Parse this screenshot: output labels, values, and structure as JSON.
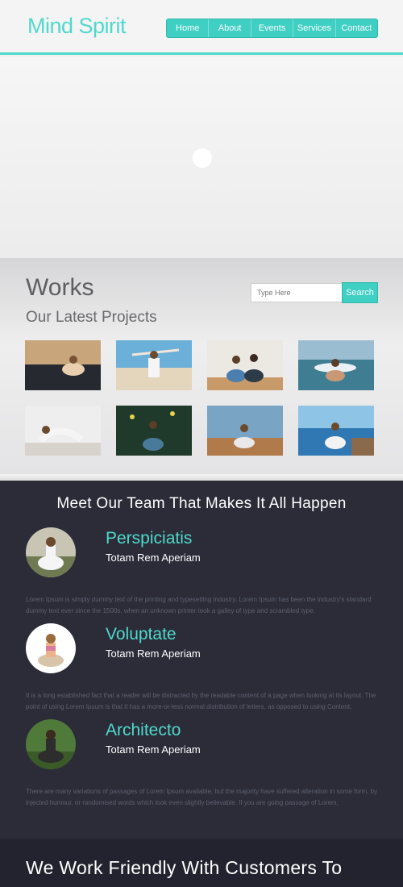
{
  "header": {
    "logo": "Mind Spirit",
    "nav": [
      "Home",
      "About",
      "Events",
      "Services",
      "Contact"
    ]
  },
  "works": {
    "title": "Works",
    "subtitle": "Our Latest Projects",
    "search_placeholder": "Type Here",
    "search_button": "Search"
  },
  "team": {
    "heading": "Meet Our Team That Makes It All Happen",
    "members": [
      {
        "name": "Perspiciatis",
        "role": "Totam Rem Aperiam",
        "desc": "Lorem Ipsum is simply dummy text of the printing and typesetting industry. Lorem Ipsum has been the industry's standard dummy text ever since the 1500s, when an unknown printer took a galley of type and scrambled type."
      },
      {
        "name": "Voluptate",
        "role": "Totam Rem Aperiam",
        "desc": "It is a long established fact that a reader will be distracted by the readable content of a page when looking at its layout. The point of using Lorem Ipsum is that it has a more-or-less normal distribution of letters, as opposed to using Content,"
      },
      {
        "name": "Architecto",
        "role": "Totam Rem Aperiam",
        "desc": "There are many variations of passages of Lorem Ipsum available, but the majority have suffered alteration in some form, by injected humour, or randomised words which look even slightly believable. If you are going passage of Lorem,"
      }
    ]
  },
  "friendly": {
    "title": "We Work Friendly With Customers To"
  },
  "colors": {
    "accent": "#4fd9cc",
    "dark_bg": "#2b2c38"
  }
}
